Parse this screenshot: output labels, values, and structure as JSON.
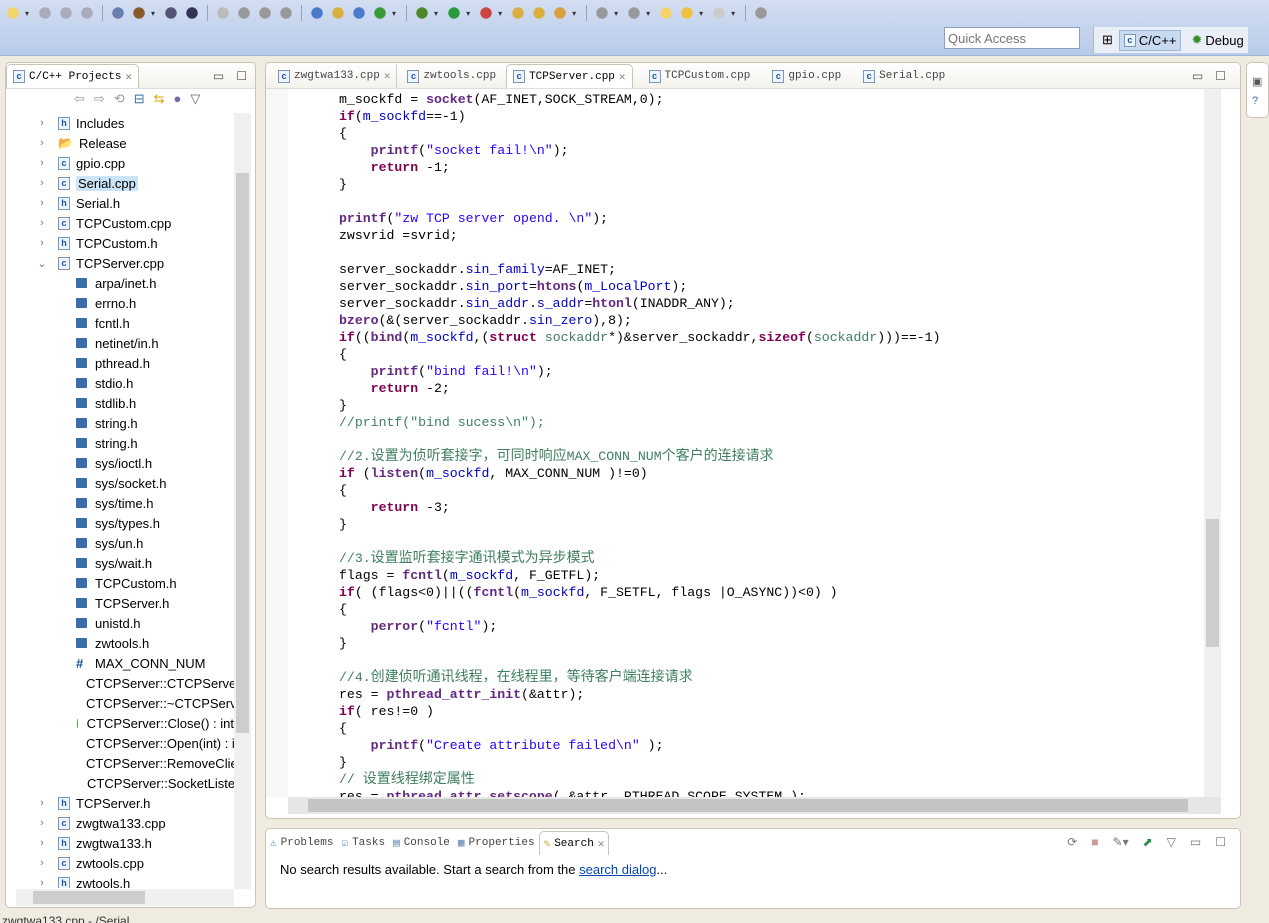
{
  "toolbar": {
    "icons": [
      "new-icon",
      "save-icon",
      "save-all-icon",
      "print-icon",
      "build-config-icon",
      "build-icon",
      "binary-icon",
      "skip-breakpoints-icon",
      "brush-icon",
      "mark-icon",
      "block-icon",
      "pilcrow-icon",
      "new-project-icon",
      "new-folder-icon",
      "new-class-icon",
      "refresh-icon",
      "debug-icon",
      "run-icon",
      "external-tools-icon",
      "open-folder-icon",
      "open-type-icon",
      "search-pen-icon",
      "next-annotation-icon",
      "prev-annotation-icon",
      "back-icon",
      "back-yellow-icon",
      "forward-icon",
      "pin-icon"
    ]
  },
  "quick_access": {
    "placeholder": "Quick Access"
  },
  "perspectives": [
    {
      "label": "C/C++",
      "active": true
    },
    {
      "label": "Debug",
      "active": false
    }
  ],
  "left_panel": {
    "title": "C/C++ Projects",
    "items": [
      {
        "label": "Includes",
        "type": "includes",
        "depth": 0,
        "twisty": ">"
      },
      {
        "label": "Release",
        "type": "folder",
        "depth": 0,
        "twisty": ">"
      },
      {
        "label": "gpio.cpp",
        "type": "c",
        "depth": 0,
        "twisty": ">"
      },
      {
        "label": "Serial.cpp",
        "type": "c",
        "depth": 0,
        "twisty": ">",
        "selected": true
      },
      {
        "label": "Serial.h",
        "type": "h",
        "depth": 0,
        "twisty": ">"
      },
      {
        "label": "TCPCustom.cpp",
        "type": "c",
        "depth": 0,
        "twisty": ">"
      },
      {
        "label": "TCPCustom.h",
        "type": "h",
        "depth": 0,
        "twisty": ">"
      },
      {
        "label": "TCPServer.cpp",
        "type": "c",
        "depth": 0,
        "twisty": "v"
      },
      {
        "label": "arpa/inet.h",
        "type": "inc",
        "depth": 1
      },
      {
        "label": "errno.h",
        "type": "inc",
        "depth": 1
      },
      {
        "label": "fcntl.h",
        "type": "inc",
        "depth": 1
      },
      {
        "label": "netinet/in.h",
        "type": "inc",
        "depth": 1
      },
      {
        "label": "pthread.h",
        "type": "inc",
        "depth": 1
      },
      {
        "label": "stdio.h",
        "type": "inc",
        "depth": 1
      },
      {
        "label": "stdlib.h",
        "type": "inc",
        "depth": 1
      },
      {
        "label": "string.h",
        "type": "inc",
        "depth": 1
      },
      {
        "label": "string.h",
        "type": "inc",
        "depth": 1
      },
      {
        "label": "sys/ioctl.h",
        "type": "inc",
        "depth": 1
      },
      {
        "label": "sys/socket.h",
        "type": "inc",
        "depth": 1
      },
      {
        "label": "sys/time.h",
        "type": "inc",
        "depth": 1
      },
      {
        "label": "sys/types.h",
        "type": "inc",
        "depth": 1
      },
      {
        "label": "sys/un.h",
        "type": "inc",
        "depth": 1
      },
      {
        "label": "sys/wait.h",
        "type": "inc",
        "depth": 1
      },
      {
        "label": "TCPCustom.h",
        "type": "inc",
        "depth": 1
      },
      {
        "label": "TCPServer.h",
        "type": "inc",
        "depth": 1
      },
      {
        "label": "unistd.h",
        "type": "inc",
        "depth": 1
      },
      {
        "label": "zwtools.h",
        "type": "inc",
        "depth": 1
      },
      {
        "label": "MAX_CONN_NUM",
        "type": "macro",
        "depth": 1
      },
      {
        "label": "CTCPServer::CTCPServer(",
        "type": "method",
        "depth": 1
      },
      {
        "label": "CTCPServer::~CTCPServer",
        "type": "method",
        "depth": 1
      },
      {
        "label": "CTCPServer::Close() : int",
        "type": "method",
        "depth": 1
      },
      {
        "label": "CTCPServer::Open(int) : int",
        "type": "method",
        "depth": 1
      },
      {
        "label": "CTCPServer::RemoveClie",
        "type": "method",
        "depth": 1
      },
      {
        "label": "CTCPServer::SocketListen",
        "type": "private-method",
        "depth": 1
      },
      {
        "label": "TCPServer.h",
        "type": "h",
        "depth": 0,
        "twisty": ">"
      },
      {
        "label": "zwgtwa133.cpp",
        "type": "c",
        "depth": 0,
        "twisty": ">"
      },
      {
        "label": "zwgtwa133.h",
        "type": "h",
        "depth": 0,
        "twisty": ">"
      },
      {
        "label": "zwtools.cpp",
        "type": "c",
        "depth": 0,
        "twisty": ">"
      },
      {
        "label": "zwtools.h",
        "type": "h",
        "depth": 0,
        "twisty": ">"
      }
    ]
  },
  "editor": {
    "tabs": [
      {
        "label": "zwgtwa133.cpp",
        "closable": true
      },
      {
        "label": "zwtools.cpp"
      },
      {
        "label": "TCPServer.cpp",
        "active": true,
        "closable": true
      },
      {
        "label": "TCPCustom.cpp"
      },
      {
        "label": "gpio.cpp"
      },
      {
        "label": "Serial.cpp"
      }
    ],
    "lines": [
      [
        [
          "pl",
          "m_sockfd = "
        ],
        [
          "fn",
          "socket"
        ],
        [
          "pl",
          "(AF_INET,SOCK_STREAM,0);"
        ]
      ],
      [
        [
          "kw",
          "if"
        ],
        [
          "pl",
          "("
        ],
        [
          "fd",
          "m_sockfd"
        ],
        [
          "pl",
          "==-1)"
        ]
      ],
      [
        [
          "pl",
          "{"
        ]
      ],
      [
        [
          "pl",
          "    "
        ],
        [
          "fn",
          "printf"
        ],
        [
          "pl",
          "("
        ],
        [
          "str",
          "\"socket fail!\\n\""
        ],
        [
          "pl",
          ");"
        ]
      ],
      [
        [
          "pl",
          "    "
        ],
        [
          "kw",
          "return"
        ],
        [
          "pl",
          " -1;"
        ]
      ],
      [
        [
          "pl",
          "}"
        ]
      ],
      [],
      [
        [
          "fn",
          "printf"
        ],
        [
          "pl",
          "("
        ],
        [
          "str",
          "\"zw TCP server opend. \\n\""
        ],
        [
          "pl",
          ");"
        ]
      ],
      [
        [
          "pl",
          "zwsvrid =svrid;"
        ]
      ],
      [],
      [
        [
          "pl",
          "server_sockaddr."
        ],
        [
          "fd",
          "sin_family"
        ],
        [
          "pl",
          "=AF_INET;"
        ]
      ],
      [
        [
          "pl",
          "server_sockaddr."
        ],
        [
          "fd",
          "sin_port"
        ],
        [
          "pl",
          "="
        ],
        [
          "fn",
          "htons"
        ],
        [
          "pl",
          "("
        ],
        [
          "fd",
          "m_LocalPort"
        ],
        [
          "pl",
          ");"
        ]
      ],
      [
        [
          "pl",
          "server_sockaddr."
        ],
        [
          "fd",
          "sin_addr"
        ],
        [
          "pl",
          "."
        ],
        [
          "fd",
          "s_addr"
        ],
        [
          "pl",
          "="
        ],
        [
          "fn",
          "htonl"
        ],
        [
          "pl",
          "(INADDR_ANY);"
        ]
      ],
      [
        [
          "fn",
          "bzero"
        ],
        [
          "pl",
          "(&(server_sockaddr."
        ],
        [
          "fd",
          "sin_zero"
        ],
        [
          "pl",
          "),8);"
        ]
      ],
      [
        [
          "kw",
          "if"
        ],
        [
          "pl",
          "(("
        ],
        [
          "fn",
          "bind"
        ],
        [
          "pl",
          "("
        ],
        [
          "fd",
          "m_sockfd"
        ],
        [
          "pl",
          ",("
        ],
        [
          "kw",
          "struct"
        ],
        [
          "pl",
          " "
        ],
        [
          "cm",
          "sockaddr"
        ],
        [
          "pl",
          "*)&server_sockaddr,"
        ],
        [
          "kw",
          "sizeof"
        ],
        [
          "pl",
          "("
        ],
        [
          "cm",
          "sockaddr"
        ],
        [
          "pl",
          ")))==-1)"
        ]
      ],
      [
        [
          "pl",
          "{"
        ]
      ],
      [
        [
          "pl",
          "    "
        ],
        [
          "fn",
          "printf"
        ],
        [
          "pl",
          "("
        ],
        [
          "str",
          "\"bind fail!\\n\""
        ],
        [
          "pl",
          ");"
        ]
      ],
      [
        [
          "pl",
          "    "
        ],
        [
          "kw",
          "return"
        ],
        [
          "pl",
          " -2;"
        ]
      ],
      [
        [
          "pl",
          "}"
        ]
      ],
      [
        [
          "cm",
          "//printf(\"bind sucess\\n\");"
        ]
      ],
      [],
      [
        [
          "cm",
          "//2."
        ],
        [
          "cm cjk",
          "设置为侦听套接字，可同时响应"
        ],
        [
          "cm",
          "MAX_CONN_NUM"
        ],
        [
          "cm cjk",
          "个客户的连接请求"
        ]
      ],
      [
        [
          "kw",
          "if"
        ],
        [
          "pl",
          " ("
        ],
        [
          "fn",
          "listen"
        ],
        [
          "pl",
          "("
        ],
        [
          "fd",
          "m_sockfd"
        ],
        [
          "pl",
          ", MAX_CONN_NUM )!=0)"
        ]
      ],
      [
        [
          "pl",
          "{"
        ]
      ],
      [
        [
          "pl",
          "    "
        ],
        [
          "kw",
          "return"
        ],
        [
          "pl",
          " -3;"
        ]
      ],
      [
        [
          "pl",
          "}"
        ]
      ],
      [],
      [
        [
          "cm",
          "//3."
        ],
        [
          "cm cjk",
          "设置监听套接字通讯模式为异步模式"
        ]
      ],
      [
        [
          "pl",
          "flags = "
        ],
        [
          "fn",
          "fcntl"
        ],
        [
          "pl",
          "("
        ],
        [
          "fd",
          "m_sockfd"
        ],
        [
          "pl",
          ", F_GETFL);"
        ]
      ],
      [
        [
          "kw",
          "if"
        ],
        [
          "pl",
          "( (flags<0)||(("
        ],
        [
          "fn",
          "fcntl"
        ],
        [
          "pl",
          "("
        ],
        [
          "fd",
          "m_sockfd"
        ],
        [
          "pl",
          ", F_SETFL, flags |O_ASYNC))<0) )"
        ]
      ],
      [
        [
          "pl",
          "{"
        ]
      ],
      [
        [
          "pl",
          "    "
        ],
        [
          "fn",
          "perror"
        ],
        [
          "pl",
          "("
        ],
        [
          "str",
          "\"fcntl\""
        ],
        [
          "pl",
          ");"
        ]
      ],
      [
        [
          "pl",
          "}"
        ]
      ],
      [],
      [
        [
          "cm",
          "//4."
        ],
        [
          "cm cjk",
          "创建侦听通讯线程，在线程里，等待客户端连接请求"
        ]
      ],
      [
        [
          "pl",
          "res = "
        ],
        [
          "fn",
          "pthread_attr_init"
        ],
        [
          "pl",
          "(&attr);"
        ]
      ],
      [
        [
          "kw",
          "if"
        ],
        [
          "pl",
          "( res!=0 )"
        ]
      ],
      [
        [
          "pl",
          "{"
        ]
      ],
      [
        [
          "pl",
          "    "
        ],
        [
          "fn",
          "printf"
        ],
        [
          "pl",
          "("
        ],
        [
          "str",
          "\"Create attribute failed\\n\""
        ],
        [
          "pl",
          " );"
        ]
      ],
      [
        [
          "pl",
          "}"
        ]
      ],
      [
        [
          "cm",
          "// "
        ],
        [
          "cm cjk",
          "设置线程绑定属性"
        ]
      ],
      [
        [
          "pl",
          "res = "
        ],
        [
          "fn",
          "pthread_attr_setscope"
        ],
        [
          "pl",
          "( &attr, PTHREAD_SCOPE_SYSTEM );"
        ]
      ]
    ]
  },
  "bottom_panel": {
    "tabs": [
      {
        "label": "Problems"
      },
      {
        "label": "Tasks"
      },
      {
        "label": "Console"
      },
      {
        "label": "Properties"
      },
      {
        "label": "Search",
        "active": true
      }
    ],
    "message": "No search results available. Start a search from the ",
    "link": "search dialog",
    "suffix": "..."
  },
  "status_bar": {
    "text": "zwgtwa133.cpp - /Serial"
  }
}
